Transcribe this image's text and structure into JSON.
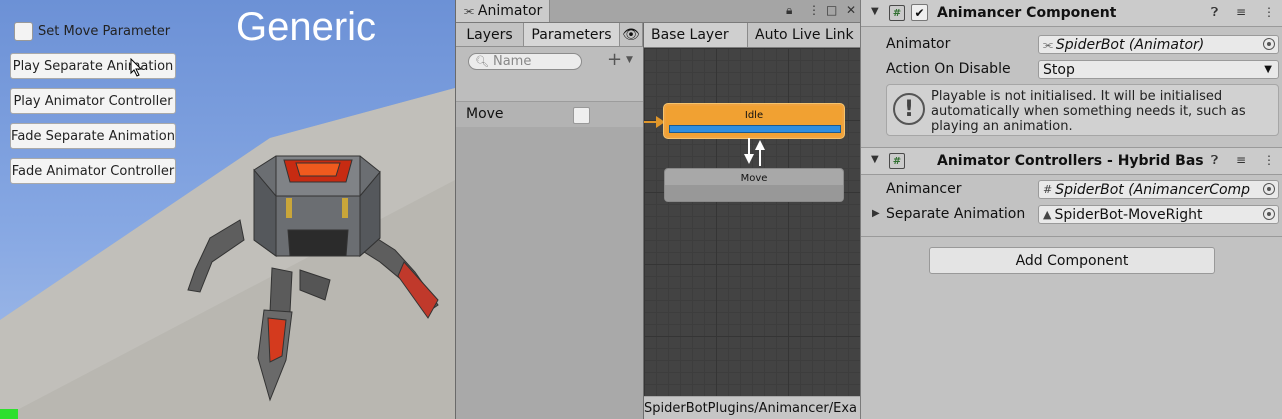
{
  "game_view": {
    "title": "Generic",
    "toggle_label": "Set Move Parameter",
    "buttons": [
      "Play Separate Animation",
      "Play Animator Controller",
      "Fade Separate Animation",
      "Fade Animator Controller"
    ]
  },
  "animator": {
    "window_tab": "Animator",
    "left_tabs": [
      "Layers",
      "Parameters"
    ],
    "search_placeholder": "Name",
    "parameter": {
      "name": "Move"
    },
    "graph_tabs": [
      "Base Layer",
      "Auto Live Link"
    ],
    "states": [
      {
        "name": "Idle",
        "active": true,
        "progress": 1.0
      },
      {
        "name": "Move",
        "active": false
      }
    ],
    "path": "SpiderBotPlugins/Animancer/Exa"
  },
  "inspector": {
    "component1": {
      "title": "Animancer Component",
      "animator_label": "Animator",
      "animator_value": "SpiderBot (Animator)",
      "action_label": "Action On Disable",
      "action_value": "Stop",
      "help_text": "Playable is not initialised. It will be initialised automatically when something needs it, such as playing an animation."
    },
    "component2": {
      "title": "Animator Controllers - Hybrid Basi",
      "animancer_label": "Animancer",
      "animancer_value": "SpiderBot (AnimancerComp",
      "separate_label": "Separate Animation",
      "separate_value": "SpiderBot-MoveRight"
    },
    "add_component": "Add Component"
  },
  "colors": {
    "sky": "#87a8e3",
    "idle_state": "#f1a132",
    "progress": "#2f8ee0",
    "graph_bg": "#434343"
  }
}
